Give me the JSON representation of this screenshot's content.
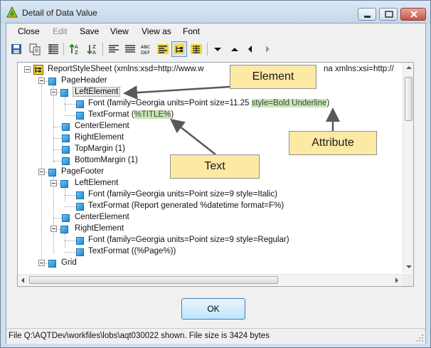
{
  "window": {
    "title": "Detail of Data Value",
    "icon": "tree-app-icon",
    "controls": [
      "minimize-icon",
      "maximize-icon",
      "close-icon"
    ]
  },
  "menu": {
    "items": [
      {
        "label": "Close",
        "enabled": true
      },
      {
        "label": "Edit",
        "enabled": false
      },
      {
        "label": "Save",
        "enabled": true
      },
      {
        "label": "View",
        "enabled": true
      },
      {
        "label": "View as",
        "enabled": true
      },
      {
        "label": "Font",
        "enabled": true
      }
    ]
  },
  "toolbar": {
    "buttons": [
      {
        "icon": "save-icon"
      },
      {
        "icon": "copy-icon"
      },
      {
        "icon": "list-view-icon"
      },
      {
        "icon": "sort-ascending-icon"
      },
      {
        "icon": "sort-descending-icon"
      },
      {
        "icon": "align-left-icon"
      },
      {
        "icon": "align-justify-icon"
      },
      {
        "icon": "abc-def-icon"
      },
      {
        "icon": "highlight-text-icon"
      },
      {
        "icon": "tree-view-icon",
        "pressed": true
      },
      {
        "icon": "grid-view-icon"
      },
      {
        "icon": "arrow-down-icon"
      },
      {
        "icon": "arrow-up-icon"
      },
      {
        "icon": "arrow-left-icon"
      },
      {
        "icon": "arrow-right-icon",
        "enabled": false
      }
    ]
  },
  "tree": {
    "root": {
      "label": "ReportStyleSheet (xmlns:xsd=http://www.w",
      "label_tail": "na xmlns:xsi=http://"
    },
    "nodes": {
      "page_header": "PageHeader",
      "ph_left": "LeftElement",
      "ph_left_font_prefix": "Font (family=Georgia units=Point size=11.25 ",
      "ph_left_font_attr": "style=Bold Underline",
      "ph_left_font_suffix": ")",
      "ph_left_tf_prefix": "TextFormat (",
      "ph_left_tf_text": "%TITLE%",
      "ph_left_tf_suffix": ")",
      "ph_center": "CenterElement",
      "ph_right": "RightElement",
      "ph_top": "TopMargin (1)",
      "ph_bottom": "BottomMargin (1)",
      "page_footer": "PageFooter",
      "pf_left": "LeftElement",
      "pf_left_font": "Font (family=Georgia units=Point size=9 style=Italic)",
      "pf_left_tf": "TextFormat (Report generated %datetime format=F%)",
      "pf_center": "CenterElement",
      "pf_right": "RightElement",
      "pf_right_font": "Font (family=Georgia units=Point size=9 style=Regular)",
      "pf_right_tf": "TextFormat ((%Page%))",
      "grid": "Grid"
    }
  },
  "callouts": {
    "element": "Element",
    "attribute": "Attribute",
    "text": "Text"
  },
  "buttons": {
    "ok": "OK"
  },
  "status": {
    "text": "File Q:\\AQTDev\\workfiles\\lobs\\aqt030022 shown. File size is 3424 bytes"
  },
  "colors": {
    "callout_fill": "#fce9a4",
    "highlight_green": "#c6e6b4",
    "node_icon": "#1e88d4"
  }
}
